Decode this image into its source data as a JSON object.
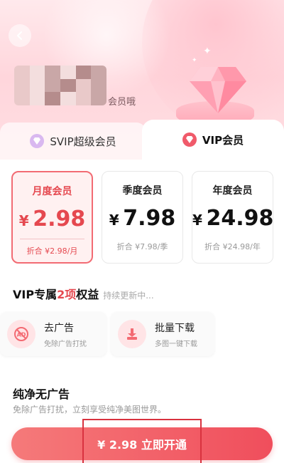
{
  "header": {
    "subtitle": "会员哦"
  },
  "tabs": [
    {
      "label": "SVIP超级会员",
      "icon": "diamond-icon",
      "selected": false
    },
    {
      "label": "VIP会员",
      "icon": "diamond-icon",
      "selected": true
    }
  ],
  "plans": [
    {
      "name": "月度会员",
      "currency": "¥",
      "price": "2.98",
      "unit": "折合 ¥2.98/月",
      "selected": true
    },
    {
      "name": "季度会员",
      "currency": "¥",
      "price": "7.98",
      "unit": "折合 ¥7.98/季",
      "selected": false
    },
    {
      "name": "年度会员",
      "currency": "¥",
      "price": "24.98",
      "unit": "折合 ¥24.98/年",
      "selected": false
    }
  ],
  "benefits": {
    "title_prefix": "VIP专属",
    "title_highlight": "2项",
    "title_suffix": "权益",
    "note": "持续更新中...",
    "items": [
      {
        "title": "去广告",
        "desc": "免除广告打扰",
        "icon": "no-ads-icon"
      },
      {
        "title": "批量下载",
        "desc": "多图一键下载",
        "icon": "download-icon"
      }
    ]
  },
  "section": {
    "title": "纯净无广告",
    "desc": "免除广告打扰，立刻享受纯净美图世界。"
  },
  "cta": {
    "label": "¥ 2.98 立即开通"
  },
  "colors": {
    "accent": "#f04e5c",
    "accent_light": "#fff1f1",
    "hero_bg": "#ffd6dc"
  }
}
